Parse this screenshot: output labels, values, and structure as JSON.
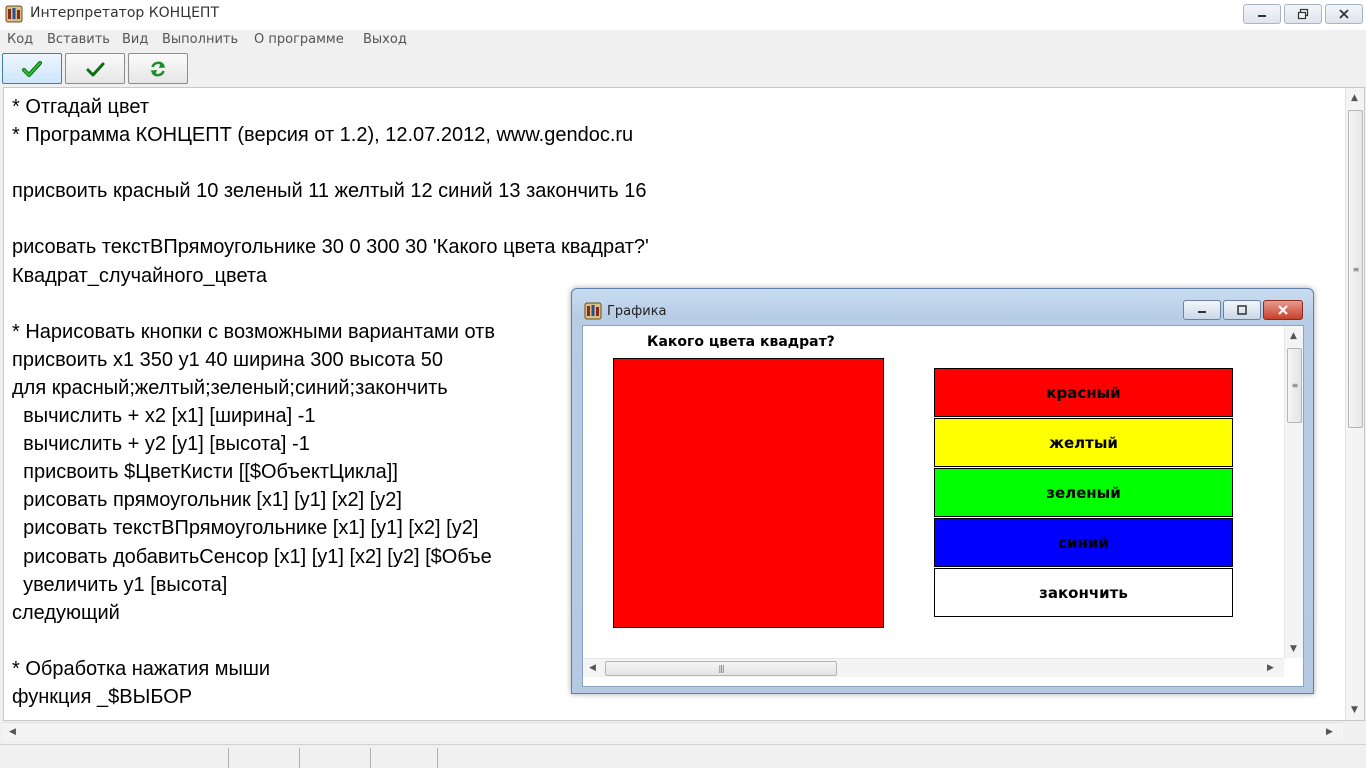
{
  "window": {
    "title": "Интерпретатор КОНЦЕПТ",
    "controls": {
      "minimize": "minimize-icon",
      "restore": "restore-icon",
      "close": "close-icon"
    }
  },
  "menu": {
    "items": [
      {
        "label": "Код"
      },
      {
        "label": "Вставить"
      },
      {
        "label": "Вид"
      },
      {
        "label": "Выполнить"
      },
      {
        "label": "О программе"
      },
      {
        "label": "Выход"
      }
    ]
  },
  "toolbar": {
    "buttons": [
      {
        "icon": "green-check-icon",
        "tooltip": ""
      },
      {
        "icon": "green-check-icon",
        "tooltip": ""
      },
      {
        "icon": "refresh-icon",
        "tooltip": ""
      }
    ]
  },
  "editor": {
    "lines": [
      "* Отгадай цвет",
      "* Программа КОНЦЕПТ (версия от 1.2), 12.07.2012, www.gendoc.ru",
      "",
      "присвоить красный 10 зеленый 11 желтый 12 синий 13 закончить 16",
      "",
      "рисовать текстВПрямоугольнике 30 0 300 30 'Какого цвета квадрат?'",
      "Квадрат_случайного_цвета",
      "",
      "* Нарисовать кнопки с возможными вариантами отв",
      "присвоить x1 350 y1 40 ширина 300 высота 50",
      "для красный;желтый;зеленый;синий;закончить",
      "  вычислить + x2 [x1] [ширина] -1",
      "  вычислить + y2 [y1] [высота] -1",
      "  присвоить $ЦветКисти [[$ОбъектЦикла]]",
      "  рисовать прямоугольник [x1] [y1] [x2] [y2]",
      "  рисовать текстВПрямоугольнике [x1] [y1] [x2] [y2]",
      "  рисовать добавитьСенсор [x1] [y1] [x2] [y2] [$Объе",
      "  увеличить y1 [высота]",
      "следующий",
      "",
      "* Обработка нажатия мыши",
      "функция _$ВЫБОР"
    ]
  },
  "graphics": {
    "title": "Графика",
    "heading": "Какого цвета квадрат?",
    "square_color": "#ff0000",
    "choices": [
      {
        "label": "красный",
        "color": "#ff0000"
      },
      {
        "label": "желтый",
        "color": "#ffff00"
      },
      {
        "label": "зеленый",
        "color": "#00ff00"
      },
      {
        "label": "синий",
        "color": "#0000ff"
      },
      {
        "label": "закончить",
        "color": "#ffffff"
      }
    ]
  }
}
